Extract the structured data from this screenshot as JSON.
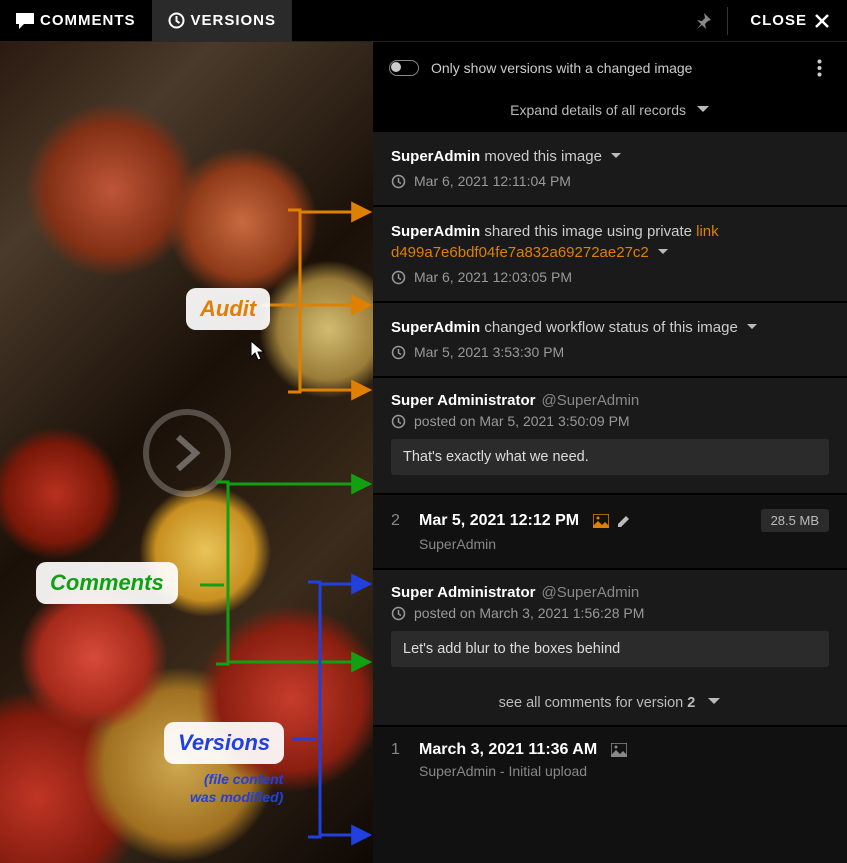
{
  "tabs": {
    "comments": "COMMENTS",
    "versions": "VERSIONS"
  },
  "close_label": "CLOSE",
  "filter": {
    "label": "Only show versions with a changed image"
  },
  "expand_label": "Expand details of all records",
  "records": [
    {
      "user": "SuperAdmin",
      "action": " moved this image",
      "timestamp": "Mar 6, 2021 12:11:04 PM"
    },
    {
      "user": "SuperAdmin",
      "action_prefix": " shared this image using private ",
      "link_label": "link ",
      "link_code": "d499a7e6bdf04fe7a832a69272ae27c2",
      "timestamp": "Mar 6, 2021 12:03:05 PM"
    },
    {
      "user": "SuperAdmin",
      "action": " changed workflow status of this image",
      "timestamp": "Mar 5, 2021 3:53:30 PM"
    }
  ],
  "comments": [
    {
      "fullname": "Super Administrator",
      "handle": "@SuperAdmin",
      "posted_label": "posted on Mar 5, 2021 3:50:09 PM",
      "body": "That's exactly what we need."
    },
    {
      "fullname": "Super Administrator",
      "handle": "@SuperAdmin",
      "posted_label": "posted on March 3, 2021 1:56:28 PM",
      "body": "Let's add blur to the boxes behind"
    }
  ],
  "versions": [
    {
      "number": "2",
      "date": "Mar 5, 2021 12:12 PM",
      "size": "28.5 MB",
      "author": "SuperAdmin"
    },
    {
      "number": "1",
      "date": "March 3, 2021 11:36 AM",
      "author_line": "SuperAdmin - Initial upload"
    }
  ],
  "see_all": {
    "prefix": "see all comments for version ",
    "num": "2"
  },
  "annotations": {
    "audit": "Audit",
    "comments": "Comments",
    "versions": "Versions",
    "subnote_line1": "(file content",
    "subnote_line2": "was modified)"
  }
}
